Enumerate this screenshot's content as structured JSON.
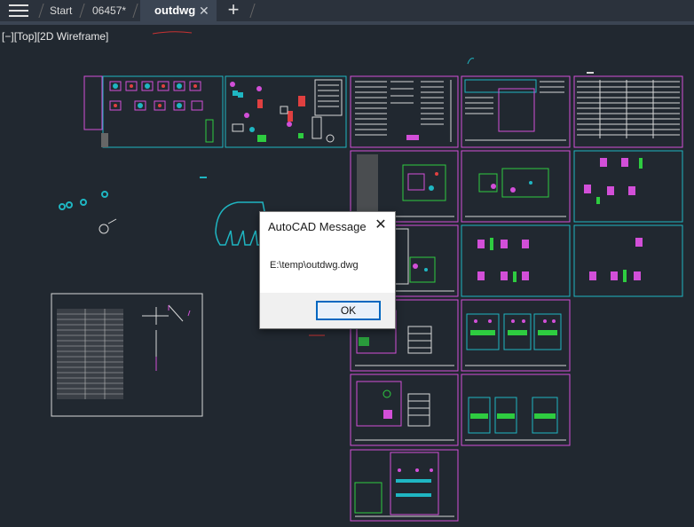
{
  "tabs": {
    "menu_icon": "hamburger-menu-icon",
    "start": "Start",
    "drawing1": "06457*",
    "active": "outdwg",
    "close_glyph": "✕",
    "add_glyph": "+"
  },
  "viewport": {
    "minus": "[−]",
    "view": "[Top]",
    "style": "[2D Wireframe]"
  },
  "dialog": {
    "title": "AutoCAD Message",
    "message": "E:\\temp\\outdwg.dwg",
    "ok_label": "OK",
    "close_glyph": "✕"
  },
  "colors": {
    "background": "#212830",
    "tabbar": "#2b323c",
    "active_tab": "#3b4553",
    "frame_magenta": "#d24fd8",
    "frame_cyan": "#1fb6c2",
    "frame_white": "#d8d8d8"
  }
}
